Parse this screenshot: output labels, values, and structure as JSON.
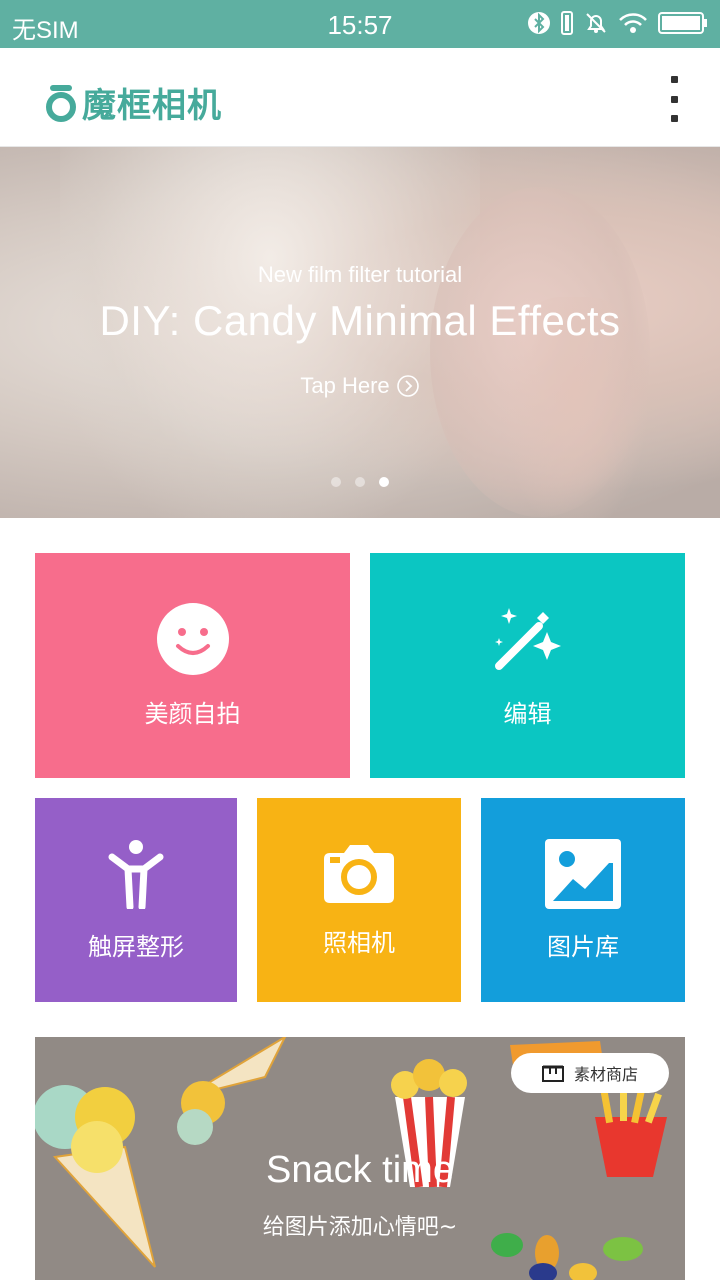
{
  "status_bar": {
    "carrier": "无SIM",
    "time": "15:57"
  },
  "header": {
    "app_name": "魔框相机",
    "brand_color": "#46aa9b"
  },
  "banner": {
    "subtitle": "New film filter tutorial",
    "title": "DIY: Candy Minimal Effects",
    "cta": "Tap Here",
    "page_count": 3,
    "active_page": 3
  },
  "tiles": {
    "selfie": {
      "label": "美颜自拍",
      "color": "#f76d8c",
      "icon": "smiley-icon"
    },
    "edit": {
      "label": "编辑",
      "color": "#0bc6c2",
      "icon": "magic-wand-icon"
    },
    "reshape": {
      "label": "触屏整形",
      "color": "#955fc8",
      "icon": "person-icon"
    },
    "camera": {
      "label": "照相机",
      "color": "#f8b314",
      "icon": "camera-icon"
    },
    "gallery": {
      "label": "图片库",
      "color": "#139edb",
      "icon": "image-icon"
    }
  },
  "promo": {
    "title": "Snack time",
    "subtitle": "给图片添加心情吧~",
    "shop_label": "素材商店"
  }
}
